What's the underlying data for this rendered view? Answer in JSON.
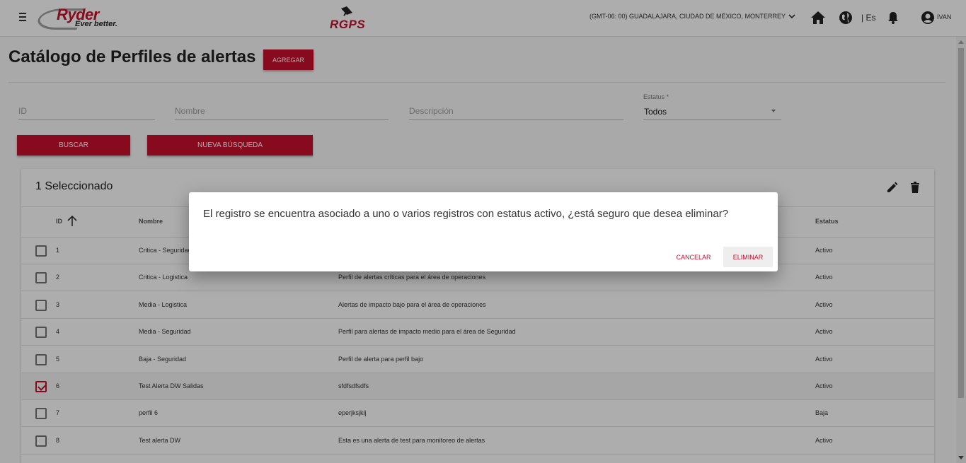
{
  "header": {
    "logo_brand": "Ryder",
    "logo_tagline": "Ever better.",
    "app_logo": "RGPS",
    "timezone": "(GMT-06: 00) GUADALAJARA, CIUDAD DE MÉXICO, MONTERREY",
    "language": "| Es",
    "user": "IVAN"
  },
  "page": {
    "title": "Catálogo de Perfiles de alertas",
    "add_button": "AGREGAR"
  },
  "filters": {
    "id_placeholder": "ID",
    "name_placeholder": "Nombre",
    "description_placeholder": "Descripción",
    "status_label": "Estatus *",
    "status_value": "Todos",
    "search_button": "BUSCAR",
    "new_search_button": "NUEVA BÚSQUEDA"
  },
  "table": {
    "selection_text": "1 Seleccionado",
    "columns": {
      "id": "ID",
      "name": "Nombre",
      "status": "Estatus"
    },
    "rows": [
      {
        "id": "1",
        "name": "Critica - Seguridad",
        "description": "",
        "status": "Activo",
        "checked": false
      },
      {
        "id": "2",
        "name": "Critica - Logistica",
        "description": "Perfil de alertas críticas para el área de operaciones",
        "status": "Activo",
        "checked": false
      },
      {
        "id": "3",
        "name": "Media - Logistica",
        "description": "Alertas de impacto bajo para el área de operaciones",
        "status": "Activo",
        "checked": false
      },
      {
        "id": "4",
        "name": "Media - Seguridad",
        "description": "Perfil para alertas de impacto medio para el área de Seguridad",
        "status": "Activo",
        "checked": false
      },
      {
        "id": "5",
        "name": "Baja - Seguridad",
        "description": "Perfil de alerta para perfil bajo",
        "status": "Activo",
        "checked": false
      },
      {
        "id": "6",
        "name": "Test Alerta DW Salidas",
        "description": "sfdfsdfsdfs",
        "status": "Activo",
        "checked": true
      },
      {
        "id": "7",
        "name": "perfil 6",
        "description": "eperjksjklj",
        "status": "Baja",
        "checked": false
      },
      {
        "id": "8",
        "name": "Test alerta DW",
        "description": "Esta es una alerta de test para monitoreo de alertas",
        "status": "Activo",
        "checked": false
      }
    ]
  },
  "dialog": {
    "message": "El registro se encuentra asociado a uno o varios registros con estatus activo, ¿está seguro que desea eliminar?",
    "cancel_label": "CANCELAR",
    "confirm_label": "ELIMINAR"
  },
  "colors": {
    "accent": "#c8102e",
    "overlay": "rgba(0,0,0,0.32)"
  }
}
